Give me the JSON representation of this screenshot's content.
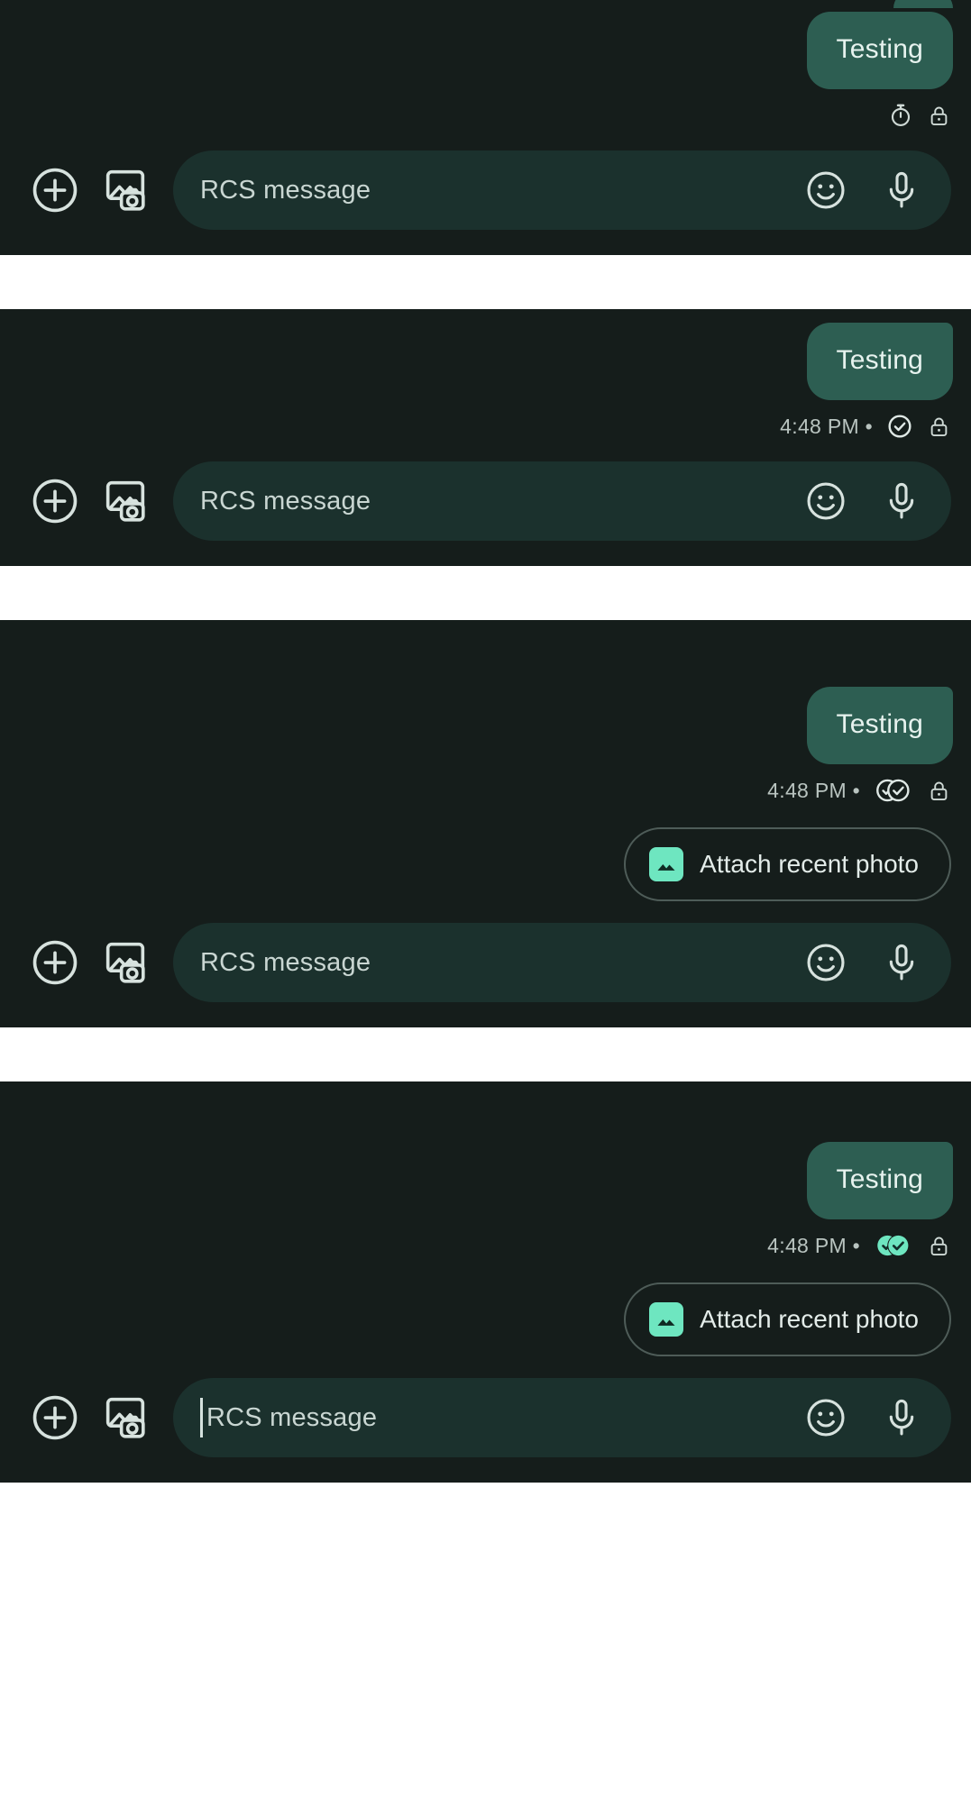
{
  "app": {
    "name": "Google Messages RCS conversation",
    "theme": "dark",
    "colors": {
      "panel_background": "#151d1b",
      "bubble_outgoing": "#2d5e52",
      "input_background": "#1b312d",
      "accent_mint": "#6ee6c0",
      "text_primary": "#e6f2ee",
      "text_secondary": "#b9c4c0",
      "gap": "#ffffff"
    }
  },
  "composer": {
    "placeholder": "RCS message",
    "attach_icon": "plus-circle-icon",
    "gallery_icon": "image-camera-icon",
    "emoji_icon": "emoji-smiley-icon",
    "mic_icon": "microphone-icon"
  },
  "suggestion_chip": {
    "label": "Attach recent photo",
    "icon": "image-icon"
  },
  "message": {
    "text": "Testing",
    "time": "4:48 PM",
    "separator": "•"
  },
  "panels": [
    {
      "id": "panel-sending",
      "has_clipped_bubble_above": true,
      "bubble_text": "Testing",
      "status": {
        "show_time": false,
        "time": "",
        "tick_state": "sending",
        "tick_icon": "stopwatch-icon",
        "lock_icon": "lock-icon"
      },
      "chip_visible": false,
      "caret_visible": false
    },
    {
      "id": "panel-sent",
      "has_clipped_bubble_above": false,
      "bubble_text": "Testing",
      "status": {
        "show_time": true,
        "time": "4:48 PM",
        "tick_state": "sent",
        "tick_icon": "check-circle-outline-icon",
        "lock_icon": "lock-icon"
      },
      "chip_visible": false,
      "caret_visible": false
    },
    {
      "id": "panel-delivered",
      "has_clipped_bubble_above": false,
      "bubble_text": "Testing",
      "status": {
        "show_time": true,
        "time": "4:48 PM",
        "tick_state": "delivered",
        "tick_icon": "double-check-circle-outline-icon",
        "lock_icon": "lock-icon"
      },
      "chip_visible": true,
      "chip_label": "Attach recent photo",
      "caret_visible": false
    },
    {
      "id": "panel-read",
      "has_clipped_bubble_above": false,
      "bubble_text": "Testing",
      "status": {
        "show_time": true,
        "time": "4:48 PM",
        "tick_state": "read",
        "tick_icon": "double-check-circle-filled-icon",
        "lock_icon": "lock-icon"
      },
      "chip_visible": true,
      "chip_label": "Attach recent photo",
      "caret_visible": true
    }
  ]
}
